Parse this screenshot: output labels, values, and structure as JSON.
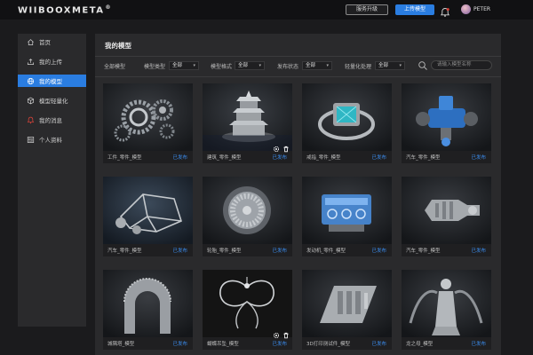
{
  "app": {
    "logo": "WIIBOOXMETA",
    "logo_mark": "®"
  },
  "header": {
    "upgrade_label": "服务升级",
    "upload_label": "上传模型",
    "username": "PETER",
    "accent_color": "#2a7de1"
  },
  "sidebar": {
    "items": [
      {
        "label": "首页",
        "icon": "home-icon"
      },
      {
        "label": "我的上传",
        "icon": "upload-icon"
      },
      {
        "label": "我的模型",
        "icon": "globe-icon",
        "active": true
      },
      {
        "label": "模型轻量化",
        "icon": "cube-icon"
      },
      {
        "label": "我的消息",
        "icon": "bell-icon"
      },
      {
        "label": "个人资料",
        "icon": "profile-icon"
      }
    ]
  },
  "main": {
    "title": "我的模型",
    "filters": {
      "all_label": "全部模型",
      "type_label": "模型类型",
      "type_value": "全部",
      "format_label": "模型格式",
      "format_value": "全部",
      "publish_label": "发布状态",
      "publish_value": "全部",
      "light_label": "轻量化处理",
      "light_value": "全部",
      "search_placeholder": "请输入模型名称"
    },
    "cards": [
      {
        "name": "工件_零件_模型",
        "status": "已发布",
        "image": "gears"
      },
      {
        "name": "建筑_零件_模型",
        "status": "已发布",
        "image": "temple",
        "hover": true
      },
      {
        "name": "戒指_零件_模型",
        "status": "已发布",
        "image": "ring"
      },
      {
        "name": "汽车_零件_模型",
        "status": "已发布",
        "image": "car-part-blue"
      },
      {
        "name": "汽车_零件_模型",
        "status": "已发布",
        "image": "car-frame"
      },
      {
        "name": "轮胎_零件_模型",
        "status": "已发布",
        "image": "wheel"
      },
      {
        "name": "发动机_零件_模型",
        "status": "已发布",
        "image": "engine"
      },
      {
        "name": "汽车_零件_模型",
        "status": "已发布",
        "image": "turbine"
      },
      {
        "name": "城隅塔_模型",
        "status": "已发布",
        "image": "arch"
      },
      {
        "name": "蝴蝶吊坠_模型",
        "status": "已发布",
        "image": "pendant",
        "hover": true
      },
      {
        "name": "3D打印测试件_模型",
        "status": "已发布",
        "image": "test-piece"
      },
      {
        "name": "龙之母_模型",
        "status": "已发布",
        "image": "statue"
      }
    ]
  }
}
